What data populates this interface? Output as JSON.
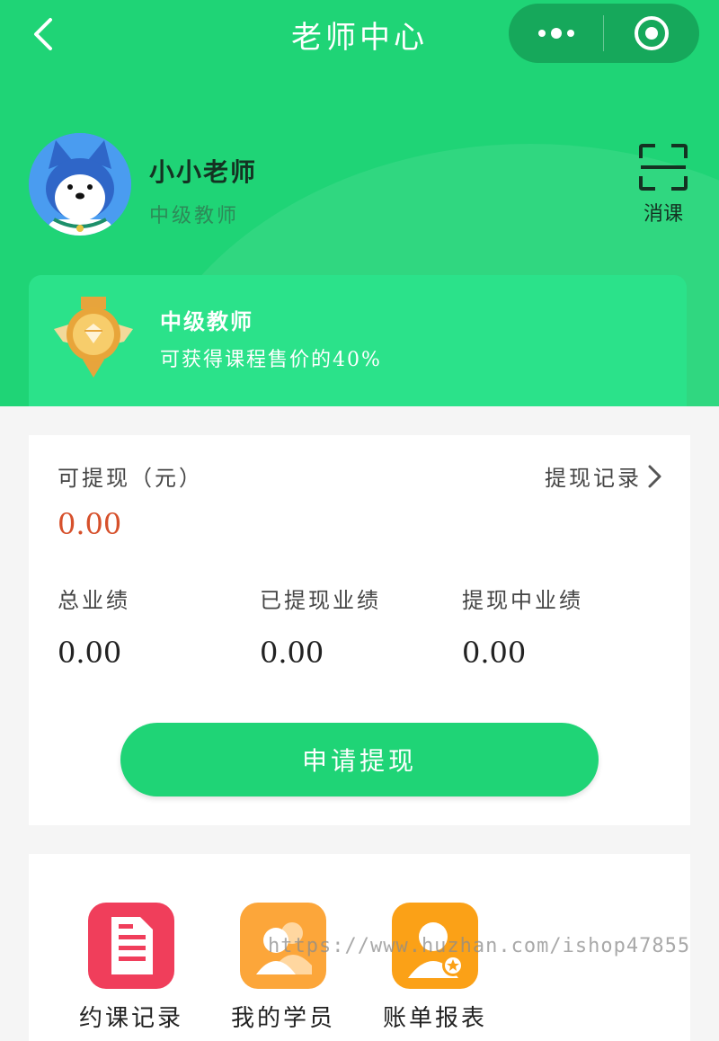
{
  "nav": {
    "title": "老师中心"
  },
  "profile": {
    "name": "小小老师",
    "level": "中级教师",
    "scan_label": "消课"
  },
  "level_card": {
    "title": "中级教师",
    "description": "可获得课程售价的40%"
  },
  "wallet": {
    "withdrawable_label": "可提现（元）",
    "withdrawable_amount": "0.00",
    "record_label": "提现记录",
    "stats": [
      {
        "label": "总业绩",
        "value": "0.00"
      },
      {
        "label": "已提现业绩",
        "value": "0.00"
      },
      {
        "label": "提现中业绩",
        "value": "0.00"
      }
    ],
    "apply_button": "申请提现"
  },
  "menu": {
    "items": [
      {
        "label": "约课记录",
        "icon": "document-icon",
        "color": "#f03e5b"
      },
      {
        "label": "我的学员",
        "icon": "students-icon",
        "color": "#fca63a"
      },
      {
        "label": "账单报表",
        "icon": "bill-user-icon",
        "color": "#fba117"
      }
    ]
  },
  "watermark": "https://www.huzhan.com/ishop47855",
  "colors": {
    "primary": "#1fd476",
    "amount": "#d6502b"
  }
}
